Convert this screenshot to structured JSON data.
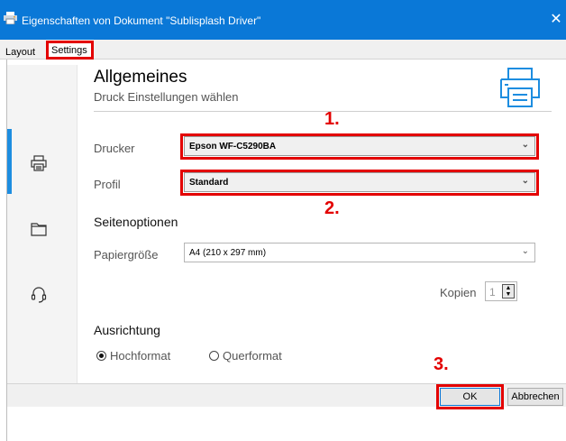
{
  "window": {
    "title": "Eigenschaften von Dokument \"Sublisplash Driver\"",
    "close_glyph": "✕",
    "accent_color": "#0a78d7"
  },
  "tabs": [
    {
      "label": "Layout",
      "selected": false
    },
    {
      "label": "Settings",
      "selected": true
    }
  ],
  "sidebar": {
    "items": [
      {
        "icon": "printer-icon",
        "selected": true
      },
      {
        "icon": "folder-icon",
        "selected": false
      },
      {
        "icon": "headset-icon",
        "selected": false
      }
    ]
  },
  "header": {
    "title": "Allgemeines",
    "subtitle": "Druck Einstellungen wählen",
    "icon": "printer-large-icon"
  },
  "fields": {
    "drucker": {
      "label": "Drucker",
      "value": "Epson WF-C5290BA"
    },
    "profil": {
      "label": "Profil",
      "value": "Standard"
    }
  },
  "seitenoptionen": {
    "heading": "Seitenoptionen",
    "papiergroesse": {
      "label": "Papiergröße",
      "value": "A4 (210 x 297 mm)"
    },
    "kopien": {
      "label": "Kopien",
      "value": "1"
    }
  },
  "ausrichtung": {
    "heading": "Ausrichtung",
    "options": [
      {
        "label": "Hochformat",
        "selected": true
      },
      {
        "label": "Querformat",
        "selected": false
      }
    ]
  },
  "buttons": {
    "ok": "OK",
    "cancel": "Abbrechen"
  },
  "annotations": {
    "step1": "1.",
    "step2": "2.",
    "step3": "3.",
    "highlight_color": "#e30000"
  }
}
